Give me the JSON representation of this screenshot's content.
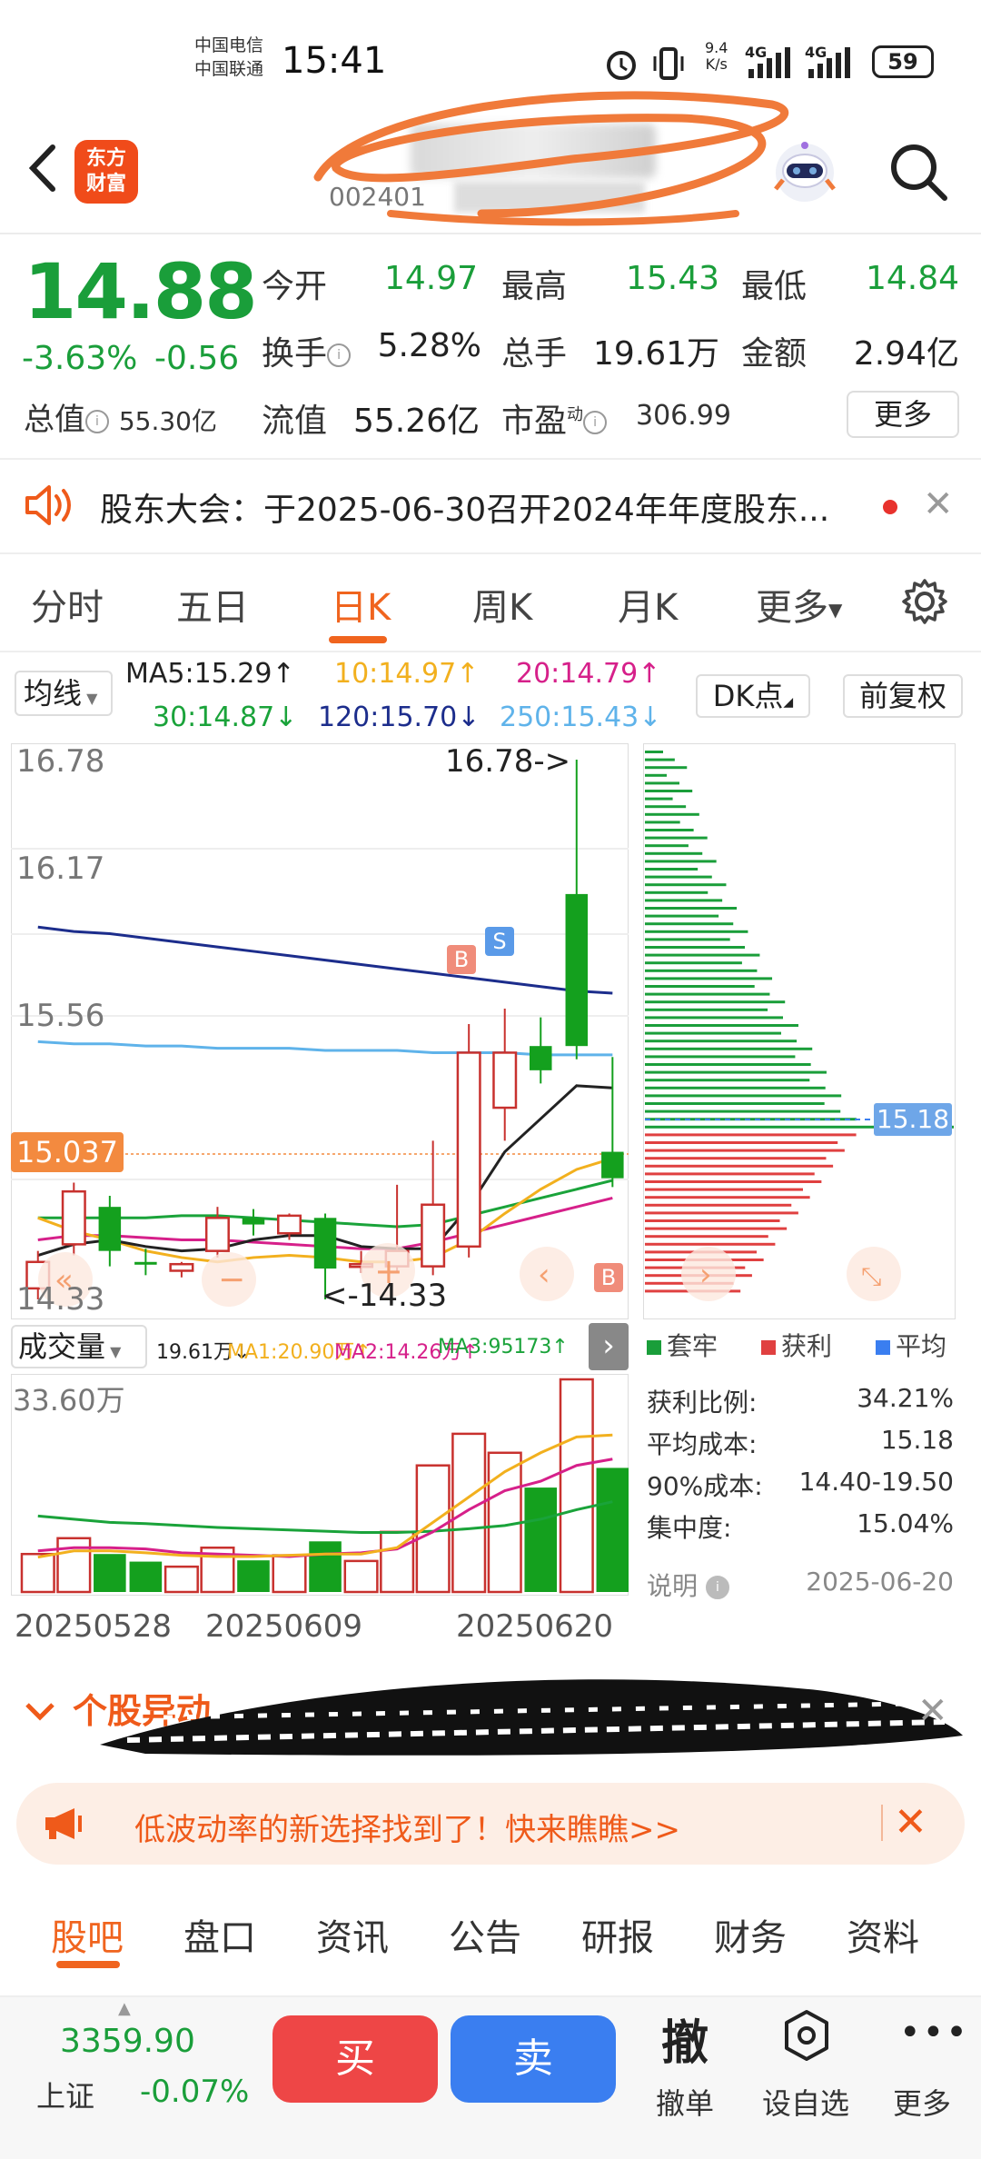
{
  "status_bar": {
    "carrier1": "中国电信",
    "carrier2": "中国联通",
    "time": "15:41",
    "net_speed_top": "9.4",
    "net_speed_bottom": "K/s",
    "signal1": "4G",
    "signal2": "4G",
    "battery": "59"
  },
  "header": {
    "logo_line1": "东方",
    "logo_line2": "财富",
    "stock_code": "002401"
  },
  "quote": {
    "price": "14.88",
    "change_pct": "-3.63%",
    "change_amt": "-0.56",
    "open_label": "今开",
    "open": "14.97",
    "high_label": "最高",
    "high": "15.43",
    "low_label": "最低",
    "low": "14.84",
    "turnover_label": "换手",
    "turnover": "5.28%",
    "volume_label": "总手",
    "volume": "19.61万",
    "amount_label": "金额",
    "amount": "2.94亿",
    "mktcap_label": "总值",
    "mktcap": "55.30亿",
    "float_label": "流值",
    "float": "55.26亿",
    "pe_label": "市盈",
    "pe_super": "动",
    "pe": "306.99",
    "more_label": "更多"
  },
  "notice": {
    "text": "股东大会：于2025-06-30召开2024年年度股东..."
  },
  "tabs": [
    "分时",
    "五日",
    "日K",
    "周K",
    "月K",
    "更多"
  ],
  "active_tab": "日K",
  "ma_bar": {
    "selector": "均线",
    "ma5": "MA5:15.29↑",
    "ma10": "10:14.97↑",
    "ma20": "20:14.79↑",
    "ma30": "30:14.87↓",
    "ma120": "120:15.70↓",
    "ma250": "250:15.43↓",
    "dk_label": "DK点",
    "fq_label": "前复权",
    "colors": {
      "ma5": "#222222",
      "ma10": "#f2b01e",
      "ma20": "#d6208a",
      "ma30": "#1aa33a",
      "ma120": "#1c2d8c",
      "ma250": "#5fb3ea"
    }
  },
  "kline": {
    "axis_top": "16.78",
    "axis_2": "16.17",
    "axis_3": "15.56",
    "axis_bottom": "14.33",
    "current_tag": "15.037",
    "max_label": "16.78->",
    "min_label": "<-14.33",
    "buy_marker": "B",
    "sell_marker": "S"
  },
  "distribution": {
    "avg_tag": "15.18",
    "legend_trapped": "套牢",
    "legend_profit": "获利",
    "legend_avg": "平均",
    "profit_ratio_label": "获利比例:",
    "profit_ratio": "34.21%",
    "avg_cost_label": "平均成本:",
    "avg_cost": "15.18",
    "cost90_label": "90%成本:",
    "cost90": "14.40-19.50",
    "concentration_label": "集中度:",
    "concentration": "15.04%",
    "note_label": "说明",
    "date": "2025-06-20"
  },
  "volume": {
    "selector": "成交量",
    "vol": "19.61万↓",
    "ma1": "MA1:20.90万↑",
    "ma2": "MA2:14.26万↑",
    "ma3": "MA3:95173↑",
    "axis_top": "33.60万",
    "dates": [
      "20250528",
      "20250609",
      "20250620"
    ]
  },
  "chart_data": {
    "type": "candlestick",
    "ylim": [
      14.33,
      16.78
    ],
    "candles": [
      {
        "o": 14.38,
        "c": 14.5,
        "h": 14.55,
        "l": 14.33,
        "dir": "up"
      },
      {
        "o": 14.58,
        "c": 14.82,
        "h": 14.86,
        "l": 14.53,
        "dir": "up"
      },
      {
        "o": 14.75,
        "c": 14.55,
        "h": 14.8,
        "l": 14.48,
        "dir": "down"
      },
      {
        "o": 14.5,
        "c": 14.5,
        "h": 14.56,
        "l": 14.44,
        "dir": "down"
      },
      {
        "o": 14.46,
        "c": 14.49,
        "h": 14.5,
        "l": 14.43,
        "dir": "up"
      },
      {
        "o": 14.55,
        "c": 14.7,
        "h": 14.75,
        "l": 14.52,
        "dir": "up"
      },
      {
        "o": 14.7,
        "c": 14.67,
        "h": 14.74,
        "l": 14.62,
        "dir": "down"
      },
      {
        "o": 14.63,
        "c": 14.71,
        "h": 14.72,
        "l": 14.6,
        "dir": "up"
      },
      {
        "o": 14.7,
        "c": 14.47,
        "h": 14.72,
        "l": 14.33,
        "dir": "down"
      },
      {
        "o": 14.48,
        "c": 14.49,
        "h": 14.55,
        "l": 14.45,
        "dir": "up"
      },
      {
        "o": 14.48,
        "c": 14.55,
        "h": 14.85,
        "l": 14.45,
        "dir": "up"
      },
      {
        "o": 14.48,
        "c": 14.76,
        "h": 15.05,
        "l": 14.44,
        "dir": "up"
      },
      {
        "o": 14.57,
        "c": 15.45,
        "h": 15.58,
        "l": 14.52,
        "dir": "up"
      },
      {
        "o": 15.2,
        "c": 15.45,
        "h": 15.65,
        "l": 15.05,
        "dir": "up"
      },
      {
        "o": 15.48,
        "c": 15.37,
        "h": 15.61,
        "l": 15.31,
        "dir": "down"
      },
      {
        "o": 16.17,
        "c": 15.48,
        "h": 16.78,
        "l": 15.42,
        "dir": "down"
      },
      {
        "o": 15.0,
        "c": 14.88,
        "h": 15.43,
        "l": 14.84,
        "dir": "down"
      }
    ],
    "volumes": [
      {
        "v": 6.0,
        "dir": "up"
      },
      {
        "v": 8.5,
        "dir": "up"
      },
      {
        "v": 6.0,
        "dir": "down"
      },
      {
        "v": 4.8,
        "dir": "down"
      },
      {
        "v": 4.0,
        "dir": "up"
      },
      {
        "v": 7.0,
        "dir": "up"
      },
      {
        "v": 5.0,
        "dir": "down"
      },
      {
        "v": 5.8,
        "dir": "up"
      },
      {
        "v": 8.0,
        "dir": "down"
      },
      {
        "v": 4.9,
        "dir": "up"
      },
      {
        "v": 9.5,
        "dir": "up"
      },
      {
        "v": 20.0,
        "dir": "up"
      },
      {
        "v": 25.0,
        "dir": "up"
      },
      {
        "v": 22.0,
        "dir": "up"
      },
      {
        "v": 16.5,
        "dir": "down"
      },
      {
        "v": 33.6,
        "dir": "up"
      },
      {
        "v": 19.61,
        "dir": "down"
      }
    ],
    "vol_ylim": [
      0,
      33.6
    ]
  },
  "promo": {
    "banner": "低波动率的新选择找到了！快来瞧瞧>>"
  },
  "bottom_tabs": [
    "股吧",
    "盘口",
    "资讯",
    "公告",
    "研报",
    "财务",
    "资料"
  ],
  "index": {
    "value": "3359.90",
    "name": "上证",
    "change": "-0.07%"
  },
  "actions": {
    "buy": "买",
    "sell": "卖",
    "cancel_icon": "撤",
    "cancel": "撤单",
    "watch": "设自选",
    "more": "更多"
  }
}
